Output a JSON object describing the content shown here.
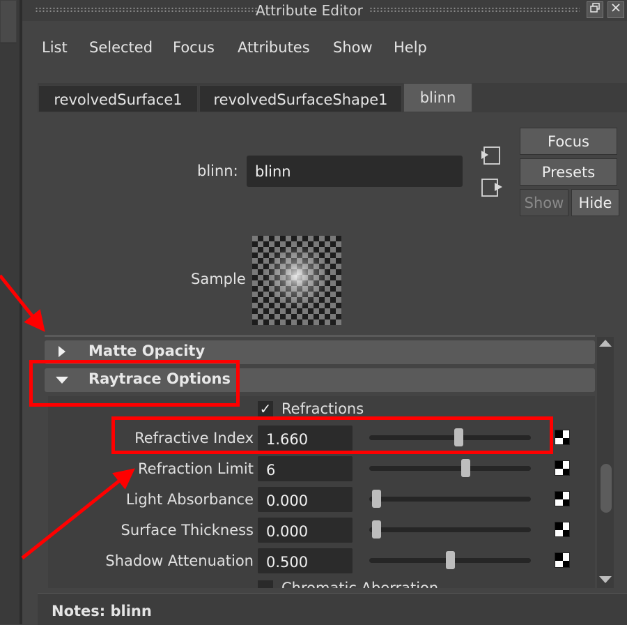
{
  "window": {
    "title": "Attribute Editor",
    "float_icon": "restore-icon",
    "close_icon": "close-icon"
  },
  "menu": [
    "List",
    "Selected",
    "Focus",
    "Attributes",
    "Show",
    "Help"
  ],
  "tabs": [
    {
      "label": "revolvedSurface1",
      "active": false
    },
    {
      "label": "revolvedSurfaceShape1",
      "active": false
    },
    {
      "label": "blinn",
      "active": true
    }
  ],
  "node": {
    "type_label": "blinn:",
    "name_value": "blinn",
    "input_icon": "input-connection-icon",
    "output_icon": "output-connection-icon"
  },
  "side_buttons": {
    "focus": "Focus",
    "presets": "Presets",
    "show": "Show",
    "hide": "Hide"
  },
  "sample": {
    "label": "Sample"
  },
  "sections": {
    "matte": {
      "label": "Matte Opacity",
      "expanded": false
    },
    "raytrace": {
      "label": "Raytrace Options",
      "expanded": true
    }
  },
  "raytrace": {
    "refractions": {
      "label": "Refractions",
      "checked": true
    },
    "attributes": [
      {
        "label": "Refractive Index",
        "value": "1.660",
        "slider": 0.55
      },
      {
        "label": "Refraction Limit",
        "value": "6",
        "slider": 0.59
      },
      {
        "label": "Light Absorbance",
        "value": "0.000",
        "slider": 0.0
      },
      {
        "label": "Surface Thickness",
        "value": "0.000",
        "slider": 0.0
      },
      {
        "label": "Shadow Attenuation",
        "value": "0.500",
        "slider": 0.5
      }
    ],
    "chromatic": {
      "label": "Chromatic Aberration",
      "checked": false
    }
  },
  "notes": {
    "label": "Notes:",
    "value": "blinn"
  },
  "annotation_color": "#ff0000"
}
